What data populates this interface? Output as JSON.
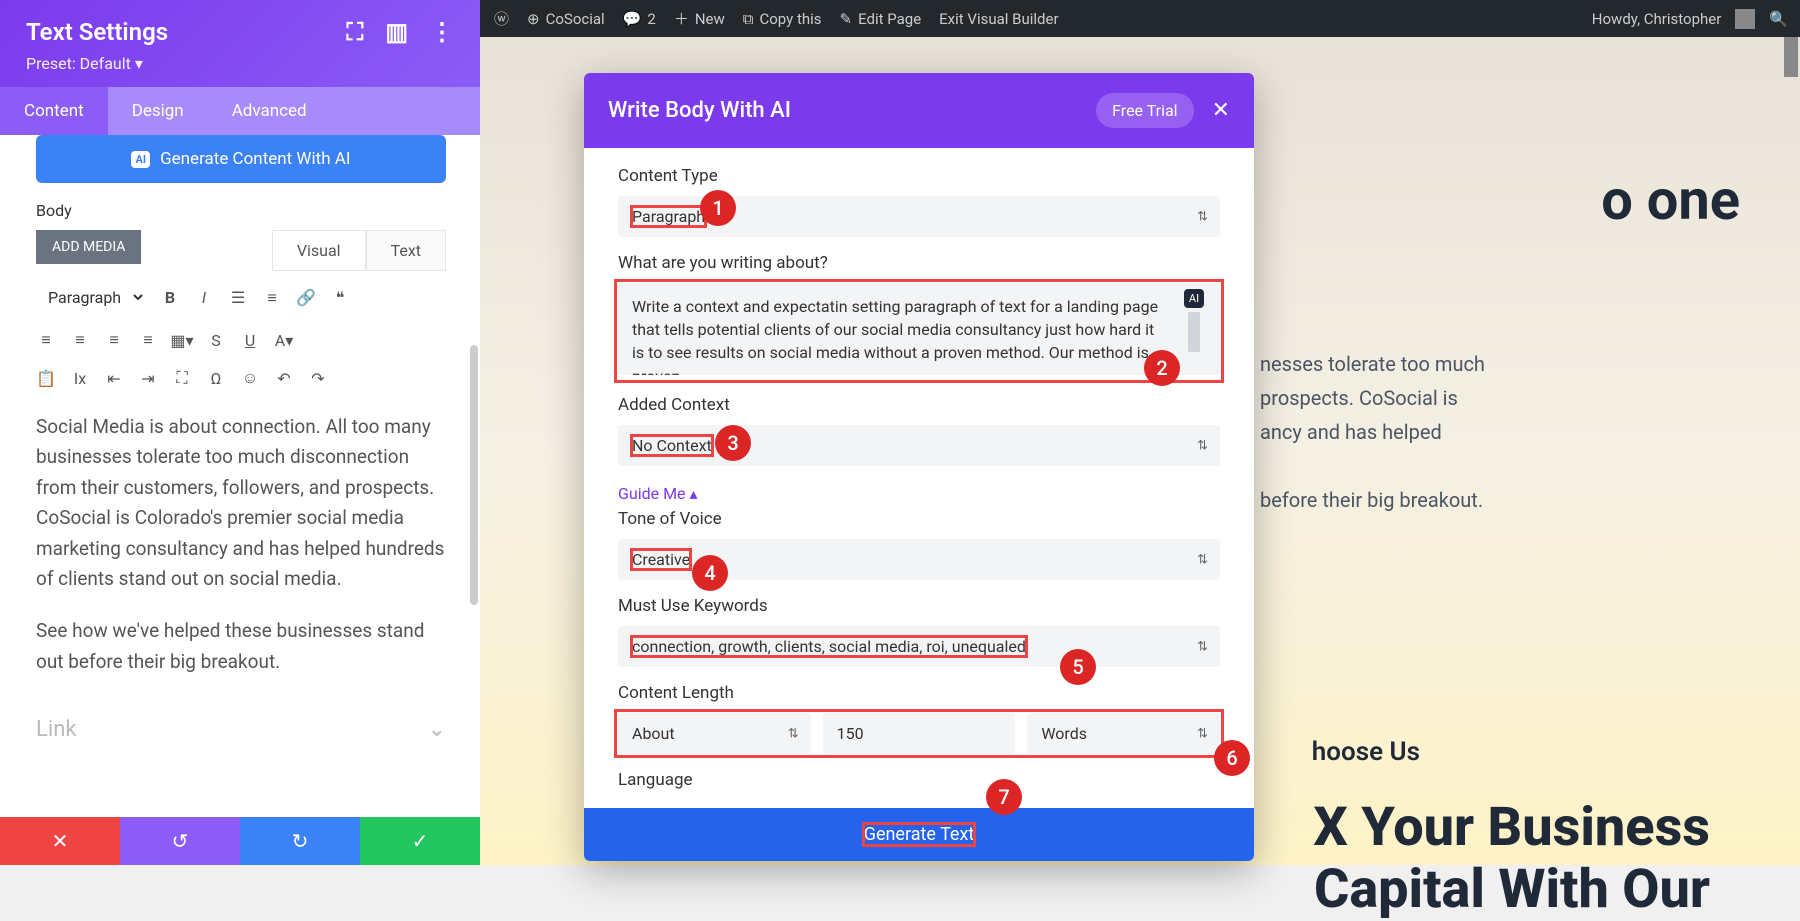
{
  "wpbar": {
    "site": "CoSocial",
    "comments": "2",
    "new": "New",
    "copy": "Copy this",
    "edit": "Edit Page",
    "exit": "Exit Visual Builder",
    "howdy": "Howdy, Christopher"
  },
  "sidebar": {
    "title": "Text Settings",
    "preset": "Preset: Default ▾",
    "tabs": {
      "content": "Content",
      "design": "Design",
      "advanced": "Advanced"
    },
    "generate": "Generate Content With AI",
    "ai_badge": "AI",
    "body_label": "Body",
    "add_media": "ADD MEDIA",
    "visual": "Visual",
    "text_tab": "Text",
    "format_sel": "Paragraph",
    "editor_p1": "Social Media is about connection. All too many businesses tolerate too much disconnection from their customers, followers, and prospects. CoSocial is Colorado's premier social media marketing consultancy and has helped hundreds of clients stand out on social media.",
    "editor_p2": "See how we've helped these businesses stand out before their big breakout.",
    "link": "Link"
  },
  "modal": {
    "title": "Write Body With AI",
    "trial": "Free Trial",
    "content_type_lbl": "Content Type",
    "content_type": "Paragraph",
    "about_lbl": "What are you writing about?",
    "about_text": "Write a context and expectatin setting paragraph of text for a landing page that tells potential clients of our social media consultancy just how hard it is to see results on social media without a proven method. Our method is proven.",
    "ai_chip": "AI",
    "context_lbl": "Added Context",
    "context": "No Context",
    "guide": "Guide Me  ▴",
    "tone_lbl": "Tone of Voice",
    "tone": "Creative",
    "keywords_lbl": "Must Use Keywords",
    "keywords": "connection, growth, clients, social media, roi, unequaled",
    "length_lbl": "Content Length",
    "length_about": "About",
    "length_num": "150",
    "length_unit": "Words",
    "language_lbl": "Language",
    "generate": "Generate Text"
  },
  "canvas": {
    "headline": "o one",
    "body1": "nesses tolerate too much",
    "body2": "prospects. CoSocial is",
    "body3": "ancy and has helped",
    "body4": "before their big breakout.",
    "choose": "hoose Us",
    "big1": "X Your Business",
    "big2": "Capital With Our"
  },
  "annotations": {
    "n1": "1",
    "n2": "2",
    "n3": "3",
    "n4": "4",
    "n5": "5",
    "n6": "6",
    "n7": "7"
  }
}
